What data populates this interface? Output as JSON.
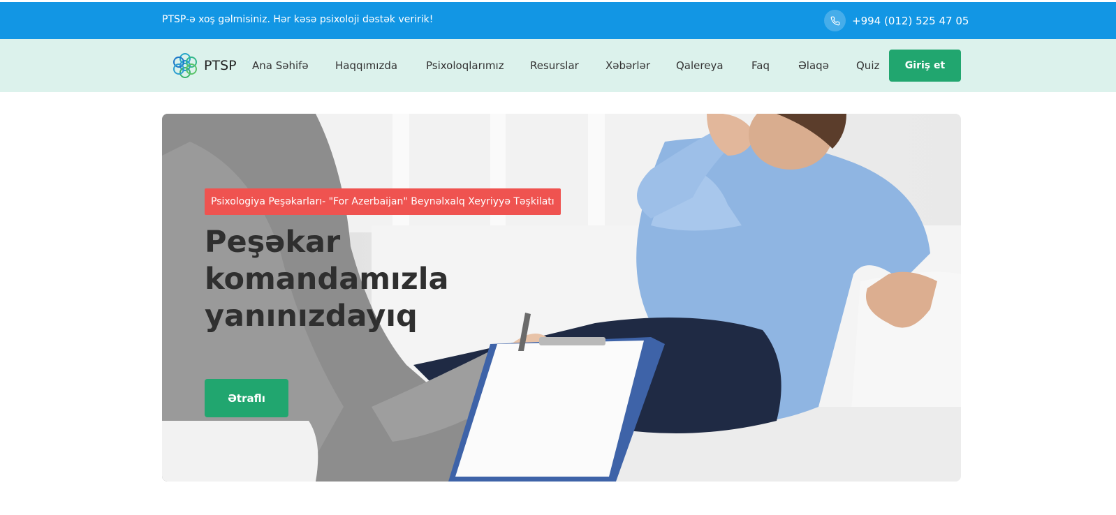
{
  "topbar": {
    "welcome": "PTSP-ə xoş gəlmisiniz. Hər kəsə psixoloji dəstək veririk!",
    "phone": "+994 (012) 525 47 05",
    "phone_icon": "phone-icon"
  },
  "brand": {
    "name": "PTSP",
    "logo_icon": "ptsp-logo-icon"
  },
  "nav": {
    "items": [
      {
        "label": "Ana Səhifə"
      },
      {
        "label": "Haqqımızda"
      },
      {
        "label": "Psixoloqlarımız"
      },
      {
        "label": "Resurslar"
      },
      {
        "label": "Xəbərlər"
      },
      {
        "label": "Qalereya"
      },
      {
        "label": "Faq"
      },
      {
        "label": "Əlaqə"
      },
      {
        "label": "Quiz"
      }
    ],
    "login_label": "Giriş et"
  },
  "hero": {
    "badge": "Psixologiya Peşəkarları- \"For Azerbaijan\" Beynəlxalq Xeyriyyə Təşkilatı",
    "title": "Peşəkar komandamızla yanınızdayıq",
    "button": "Ətraflı"
  },
  "colors": {
    "topbar": "#1296e4",
    "navbar": "#dcf2ec",
    "accent_green": "#21a66f",
    "badge_red": "#ef5350"
  }
}
